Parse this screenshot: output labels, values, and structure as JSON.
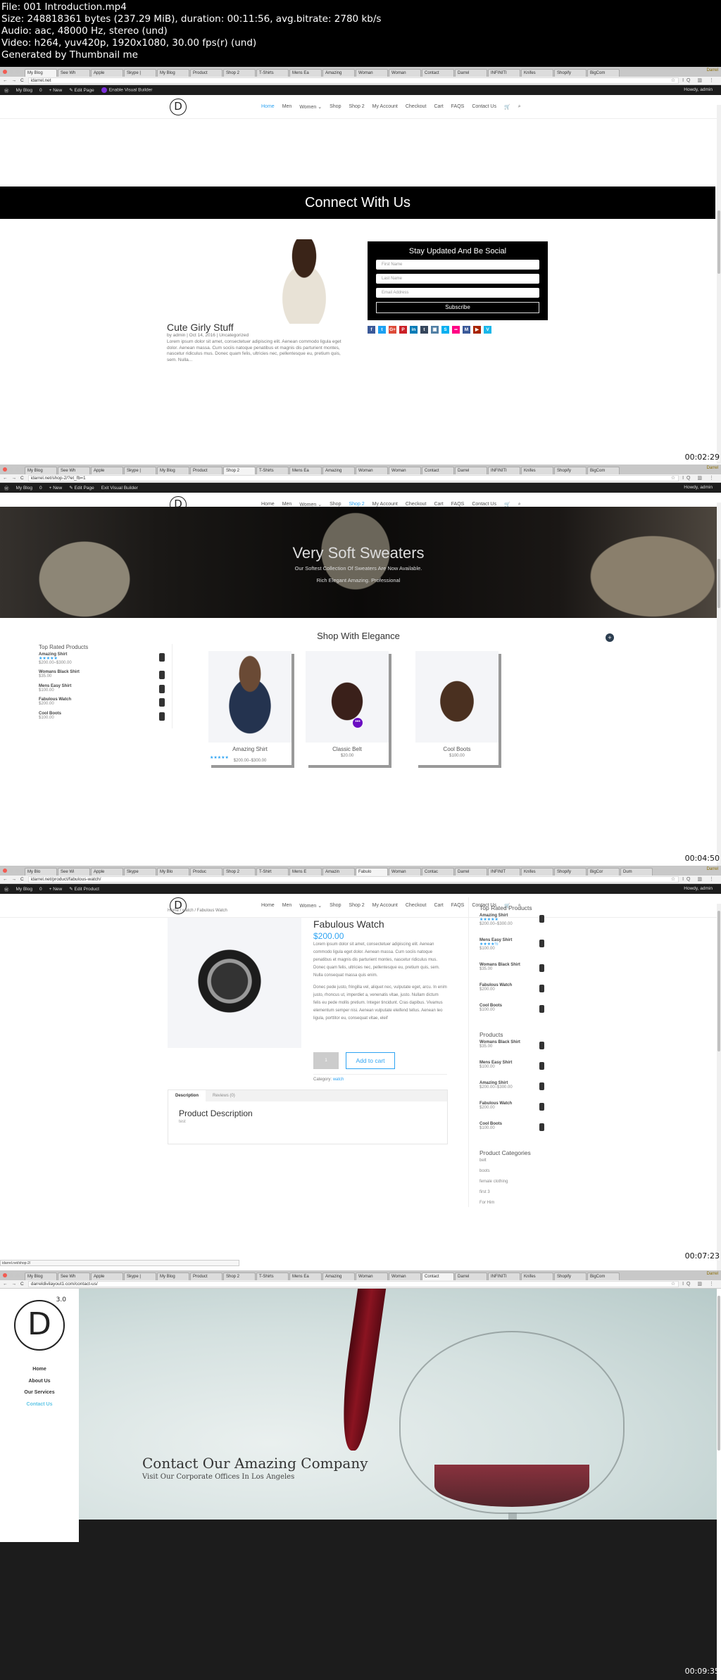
{
  "file_info": {
    "lines": [
      "File: 001 Introduction.mp4",
      "Size: 248818361 bytes (237.29 MiB), duration: 00:11:56, avg.bitrate: 2780 kb/s",
      "Audio: aac, 48000 Hz, stereo (und)",
      "Video: h264, yuv420p, 1920x1080, 30.00 fps(r) (und)",
      "Generated by Thumbnail me"
    ]
  },
  "browser": {
    "user_label": "Darrel",
    "tabs_f1": [
      "My Blog",
      "See Wh",
      "Apple",
      "Skype |",
      "My Blog",
      "Product",
      "Shop 2",
      "T-Shirts",
      "Mens Ea",
      "Amazing",
      "Woman",
      "Woman",
      "Contact",
      "Darrel",
      "INFINITI",
      "Knifes",
      "Shopify",
      "BigCom"
    ],
    "tabs_f3": [
      "My Blo",
      "See Wi",
      "Apple",
      "Skype",
      "My Blo",
      "Produc",
      "Shop 2",
      "T-Shirt",
      "Mens E",
      "Amazin",
      "Fabulo",
      "Woman",
      "Contac",
      "Darrel",
      "INFINIT",
      "Knifes",
      "Shopify",
      "BigCor",
      "Dum"
    ],
    "icons": "☆ IQ ▥ ⋮"
  },
  "wp_admin": {
    "site": "My Blog",
    "comments": "0",
    "new": "New",
    "edit_page": "Edit Page",
    "edit_product": "Edit Product",
    "enable_vb": "Enable Visual Builder",
    "exit_vb": "Exit Visual Builder",
    "howdy": "Howdy, admin"
  },
  "site_menu": [
    "Home",
    "Men",
    "Women ⌄",
    "Shop",
    "Shop 2",
    "My Account",
    "Checkout",
    "Cart",
    "FAQS",
    "Contact Us"
  ],
  "frames": [
    {
      "url": "idarrel.net",
      "timestamp": "00:02:29",
      "connect_heading": "Connect With Us",
      "post": {
        "title": "Cute Girly Stuff",
        "meta": "by admin | Oct 14, 2016 | Uncategorized",
        "excerpt": "Lorem ipsum dolor sit amet, consectetuer adipiscing elit. Aenean commodo ligula eget dolor. Aenean massa. Cum sociis natoque penatibus et magnis dis parturient montes, nascetur ridiculus mus. Donec quam felis, ultricies nec, pellentesque eu, pretium quis, sem. Nulla..."
      },
      "subscribe": {
        "title": "Stay Updated And Be Social",
        "first_name": "First Name",
        "last_name": "Last Name",
        "email": "Email Address",
        "button": "Subscribe"
      },
      "social_icons": [
        {
          "name": "facebook",
          "glyph": "f",
          "color": "#3b5998"
        },
        {
          "name": "twitter",
          "glyph": "t",
          "color": "#1da1f2"
        },
        {
          "name": "google-plus",
          "glyph": "G+",
          "color": "#dd4b39"
        },
        {
          "name": "pinterest",
          "glyph": "P",
          "color": "#cb2027"
        },
        {
          "name": "linkedin",
          "glyph": "in",
          "color": "#007bb6"
        },
        {
          "name": "tumblr",
          "glyph": "t",
          "color": "#35465c"
        },
        {
          "name": "instagram",
          "glyph": "▣",
          "color": "#517fa4"
        },
        {
          "name": "skype",
          "glyph": "S",
          "color": "#00aff0"
        },
        {
          "name": "flickr",
          "glyph": "••",
          "color": "#ff0084"
        },
        {
          "name": "myspace",
          "glyph": "M",
          "color": "#3a5998"
        },
        {
          "name": "youtube",
          "glyph": "▶",
          "color": "#a82400"
        },
        {
          "name": "vimeo",
          "glyph": "V",
          "color": "#1ab7ea"
        }
      ]
    },
    {
      "url": "idarrel.net/shop-2/?et_fb=1",
      "timestamp": "00:04:50",
      "hero": {
        "title": "Very Soft Sweaters",
        "subtitle": "Our Softest Collection Of Sweaters Are Now Available.",
        "tagline": "Rich Elegant Amazing. Professional"
      },
      "shop_title": "Shop With Elegance",
      "top_rated": {
        "title": "Top Rated Products",
        "items": [
          {
            "name": "Amazing Shirt",
            "stars": "★★★★★",
            "price": "$200.00–$300.00"
          },
          {
            "name": "Womans Black Shirt",
            "price": "$35.00"
          },
          {
            "name": "Mens Easy Shirt",
            "price": "$100.00"
          },
          {
            "name": "Fabulous Watch",
            "price": "$200.00"
          },
          {
            "name": "Cool Boots",
            "price": "$100.00"
          }
        ]
      },
      "products": [
        {
          "name": "Amazing Shirt",
          "stars": "★★★★★",
          "price": "$200.00–$300.00"
        },
        {
          "name": "Classic Belt",
          "price": "$20.00"
        },
        {
          "name": "Cool Boots",
          "price": "$100.00"
        }
      ]
    },
    {
      "url": "idarrel.net/product/fabulous-watch/",
      "timestamp": "00:07:23",
      "breadcrumb": "Home / watch / Fabulous Watch",
      "product": {
        "title": "Fabulous Watch",
        "price": "$200.00",
        "desc1": "Lorem ipsum dolor sit amet, consectetuer adipiscing elit. Aenean commodo ligula eget dolor. Aenean massa. Cum sociis natoque penatibus et magnis dis parturient montes, nascetur ridiculus mus. Donec quam felis, ultricies nec, pellentesque eu, pretium quis, sem. Nulla consequat massa quis enim.",
        "desc2": "Donec pede justo, fringilla vel, aliquet nec, vulputate eget, arcu. In enim justo, rhoncus ut, imperdiet a, venenatis vitae, justo. Nullam dictum felis eu pede mollis pretium. Integer tincidunt. Cras dapibus. Vivamus elementum semper nisi. Aenean vulputate eleifend tellus. Aenean leo ligula, porttitor eu, consequat vitae, eleif",
        "qty": "1",
        "add_to_cart": "Add to cart",
        "category_label": "Category:",
        "category": "watch"
      },
      "tabs": {
        "description": "Description",
        "reviews": "Reviews (0)",
        "heading": "Product Description",
        "body": "test"
      },
      "sidebar": {
        "top_rated_title": "Top Rated Products",
        "top_rated": [
          {
            "name": "Amazing Shirt",
            "stars": "★★★★★",
            "price": "$200.00–$300.00"
          },
          {
            "name": "Mens Easy Shirt",
            "stars": "★★★★½",
            "price": "$100.00"
          },
          {
            "name": "Womans Black Shirt",
            "price": "$35.00"
          },
          {
            "name": "Fabulous Watch",
            "price": "$200.00"
          },
          {
            "name": "Cool Boots",
            "price": "$100.00"
          }
        ],
        "products_title": "Products",
        "products": [
          {
            "name": "Womans Black Shirt",
            "price": "$35.00"
          },
          {
            "name": "Mens Easy Shirt",
            "price": "$100.00"
          },
          {
            "name": "Amazing Shirt",
            "price": "$200.00–$300.00"
          },
          {
            "name": "Fabulous Watch",
            "price": "$200.00"
          },
          {
            "name": "Cool Boots",
            "price": "$100.00"
          }
        ],
        "categories_title": "Product Categories",
        "categories": [
          "belt",
          "boots",
          "female clothing",
          "first 3",
          "For Him"
        ]
      },
      "status_url": "idarrel.net/shop-2/"
    },
    {
      "url": "darreldivilayout1.com/contact-us/",
      "timestamp": "00:09:35",
      "logo_version": "3.0",
      "menu": [
        "Home",
        "About Us",
        "Our Services",
        "Contact Us"
      ],
      "hero_title": "Contact Our Amazing Company",
      "hero_subtitle": "Visit Our Corporate Offices In Los Angeles"
    }
  ]
}
